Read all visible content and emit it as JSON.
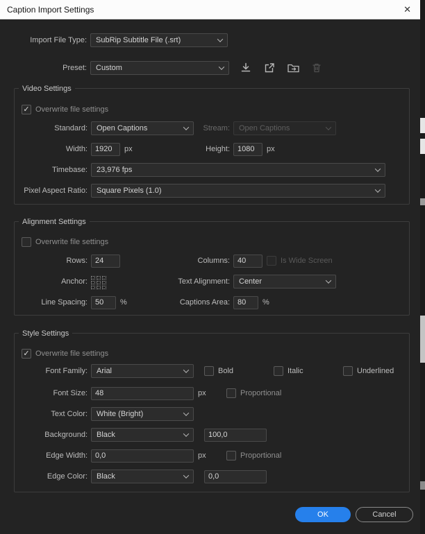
{
  "dialog": {
    "title": "Caption Import Settings",
    "close_glyph": "✕"
  },
  "glyphs": {
    "check": "✓"
  },
  "colors": {
    "accent_blue": "#2680eb",
    "dialog_bg": "#232323",
    "titlebar_bg": "#fcfcfc"
  },
  "import_file_type": {
    "label": "Import File Type:",
    "value": "SubRip Subtitle File (.srt)"
  },
  "preset": {
    "label": "Preset:",
    "value": "Custom",
    "icons": [
      "save-preset-icon",
      "export-preset-icon",
      "import-preset-icon",
      "delete-preset-icon"
    ]
  },
  "video_settings": {
    "title": "Video Settings",
    "overwrite": {
      "label": "Overwrite file settings",
      "checked": true
    },
    "standard": {
      "label": "Standard:",
      "value": "Open Captions"
    },
    "stream": {
      "label": "Stream:",
      "value": "Open Captions",
      "disabled": true
    },
    "width": {
      "label": "Width:",
      "value": "1920",
      "unit": "px"
    },
    "height": {
      "label": "Height:",
      "value": "1080",
      "unit": "px"
    },
    "timebase": {
      "label": "Timebase:",
      "value": "23,976 fps"
    },
    "pixel_aspect_ratio": {
      "label": "Pixel Aspect Ratio:",
      "value": "Square Pixels (1.0)"
    }
  },
  "alignment_settings": {
    "title": "Alignment Settings",
    "overwrite": {
      "label": "Overwrite file settings",
      "checked": false
    },
    "rows": {
      "label": "Rows:",
      "value": "24"
    },
    "columns": {
      "label": "Columns:",
      "value": "40"
    },
    "is_wide_screen": {
      "label": "Is Wide Screen",
      "checked": false,
      "disabled": true
    },
    "anchor": {
      "label": "Anchor:"
    },
    "text_alignment": {
      "label": "Text Alignment:",
      "value": "Center"
    },
    "line_spacing": {
      "label": "Line Spacing:",
      "value": "50",
      "unit": "%"
    },
    "captions_area": {
      "label": "Captions Area:",
      "value": "80",
      "unit": "%"
    }
  },
  "style_settings": {
    "title": "Style Settings",
    "overwrite": {
      "label": "Overwrite file settings",
      "checked": true
    },
    "font_family": {
      "label": "Font Family:",
      "value": "Arial"
    },
    "bold": {
      "label": "Bold",
      "checked": false
    },
    "italic": {
      "label": "Italic",
      "checked": false
    },
    "underlined": {
      "label": "Underlined",
      "checked": false
    },
    "font_size": {
      "label": "Font Size:",
      "value": "48",
      "unit": "px"
    },
    "proportional_size": {
      "label": "Proportional",
      "checked": false
    },
    "text_color": {
      "label": "Text Color:",
      "value": "White (Bright)"
    },
    "background": {
      "label": "Background:",
      "value": "Black",
      "opacity": "100,0"
    },
    "edge_width": {
      "label": "Edge Width:",
      "value": "0,0",
      "unit": "px"
    },
    "proportional_edge": {
      "label": "Proportional",
      "checked": false
    },
    "edge_color": {
      "label": "Edge Color:",
      "value": "Black",
      "opacity": "0,0"
    }
  },
  "footer": {
    "ok": "OK",
    "cancel": "Cancel"
  }
}
